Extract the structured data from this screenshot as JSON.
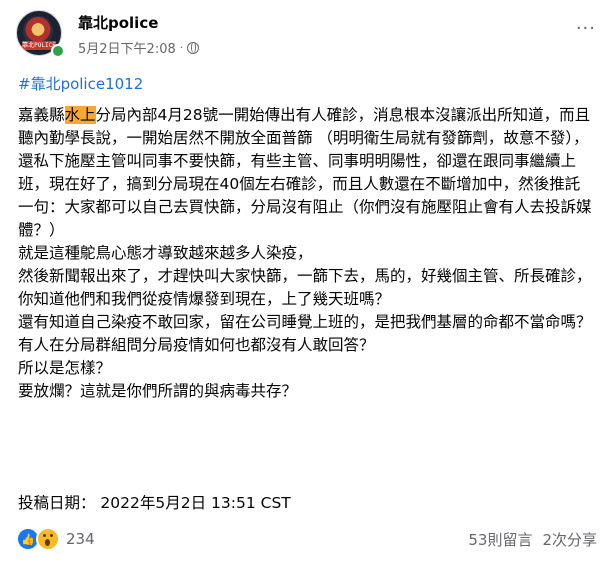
{
  "post": {
    "page_name": "靠北police",
    "timestamp": "5月2日下午2:08",
    "separator": "·",
    "hashtag": "#靠北police1012",
    "body_pre": "嘉義縣",
    "body_highlight": "水上",
    "body_post": "分局內部4月28號一開始傳出有人確診，消息根本沒讓派出所知道，而且聽內勤學長說，一開始居然不開放全面普篩 （明明衛生局就有發篩劑，故意不發），",
    "lines": [
      "還私下施壓主管叫同事不要快篩，有些主管、同事明明陽性，卻還在跟同事繼續上班，現在好了，搞到分局現在40個左右確診，而且人數還在不斷增加中，然後推託一句：大家都可以自己去買快篩，分局沒有阻止（你們沒有施壓阻止會有人去投訴媒體？）",
      "就是這種鴕鳥心態才導致越來越多人染疫，",
      "然後新聞報出來了，才趕快叫大家快篩，一篩下去，馬的，好幾個主管、所長確診，你知道他們和我們從疫情爆發到現在，上了幾天班嗎？",
      "還有知道自己染疫不敢回家，留在公司睡覺上班的，是把我們基層的命都不當命嗎？",
      "有人在分局群組問分局疫情如何也都沒有人敢回答？",
      "所以是怎樣？",
      "要放爛？這就是你們所謂的與病毒共存？"
    ],
    "submission_line": "投稿日期：  2022年5月2日 13:51 CST",
    "reaction_count": "234",
    "comments": "53則留言",
    "shares": "2次分享",
    "avatar_tag": "靠北POLICE",
    "more_label": "···"
  },
  "icons": {
    "like": "like-icon",
    "wow": "wow-icon",
    "globe": "globe-icon",
    "more": "more-options-icon"
  },
  "colors": {
    "link": "#216fdb",
    "highlight": "#f7a734",
    "muted": "#65676b",
    "like": "#1877f2",
    "online": "#31a24c"
  }
}
